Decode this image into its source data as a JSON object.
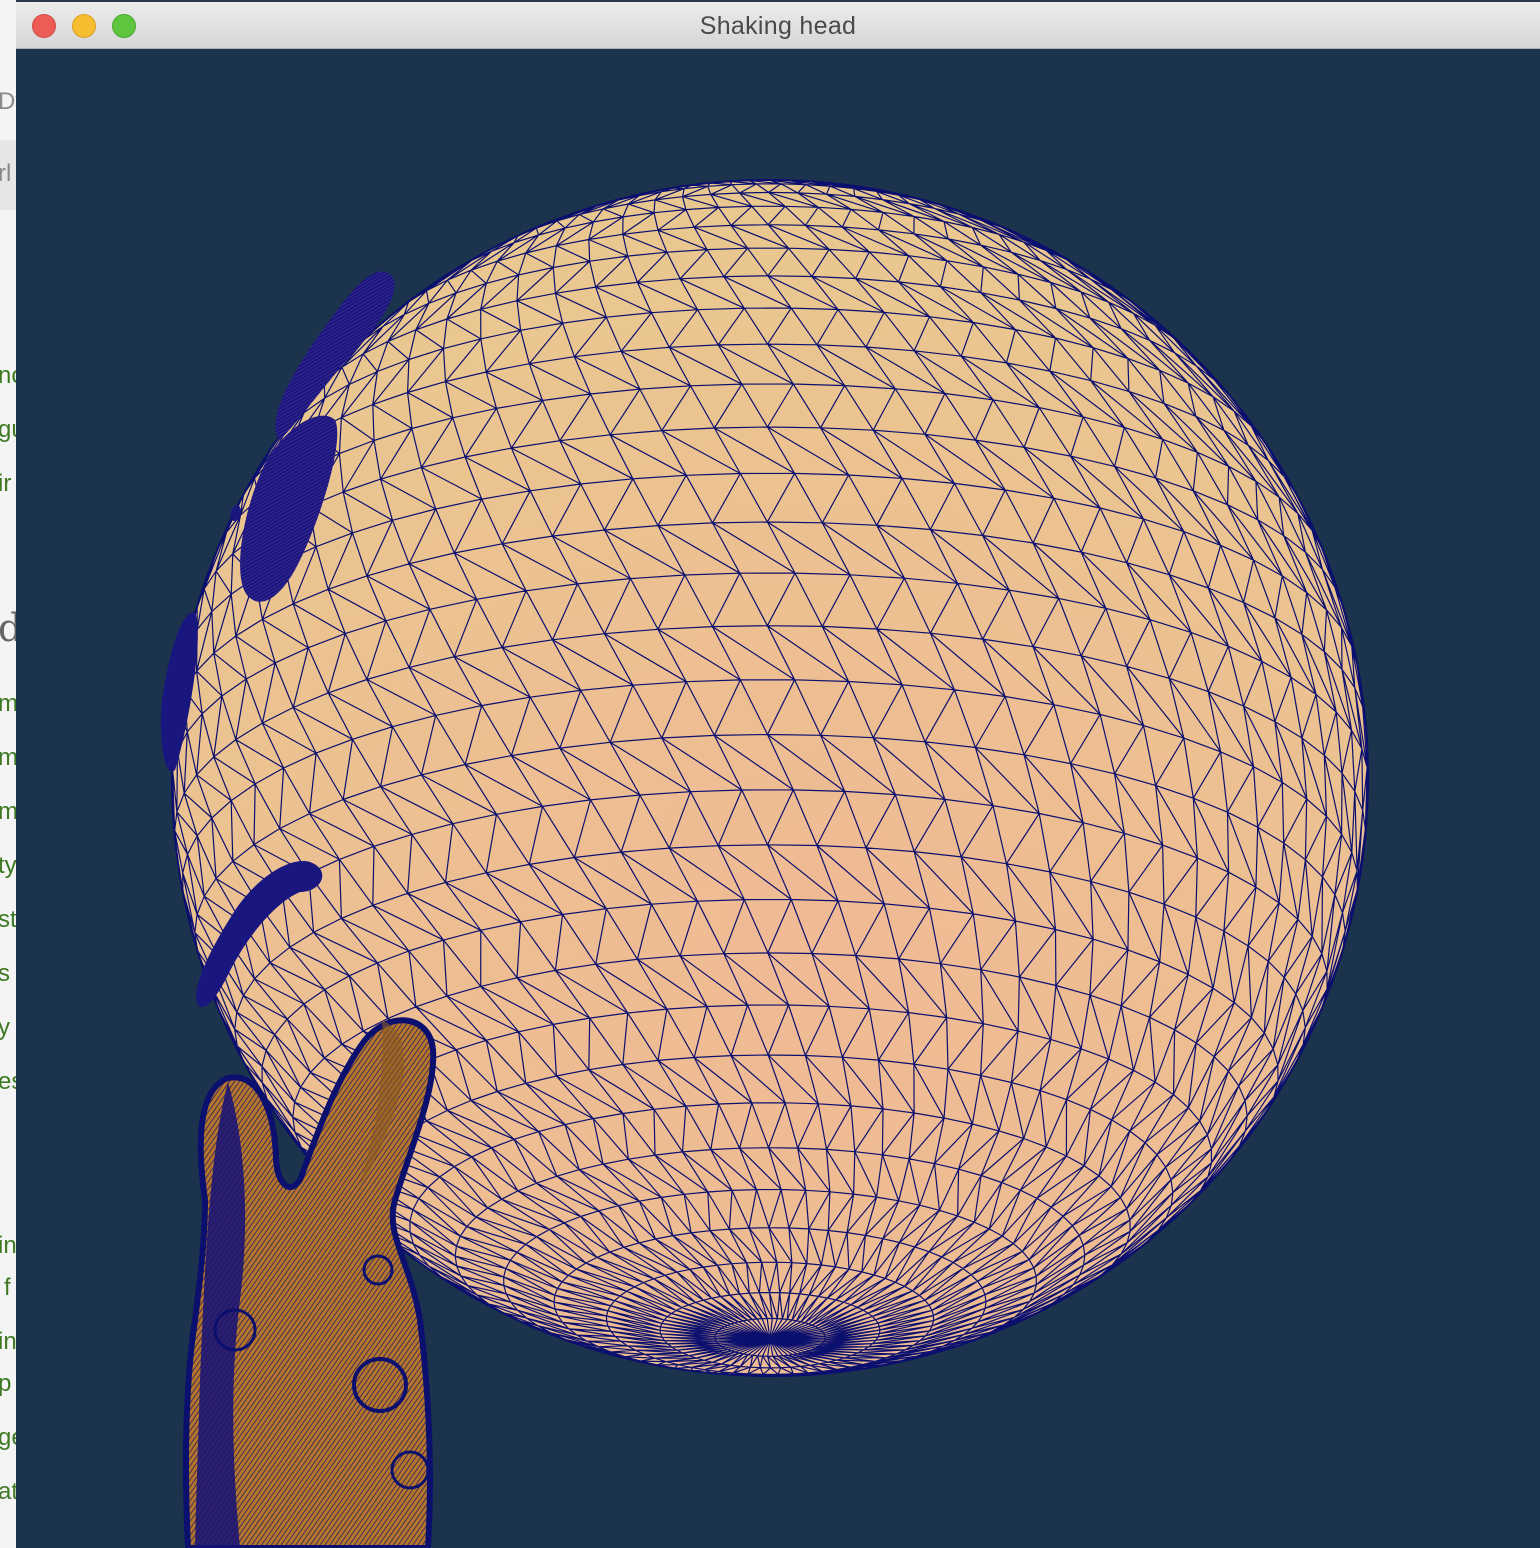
{
  "window": {
    "title": "Shaking head"
  },
  "background_window": {
    "fragments": [
      "Dv",
      "rl",
      "nc",
      "gu",
      "ir",
      "d",
      "m",
      "m",
      "m",
      "ty",
      "st",
      "s",
      "y s",
      "es",
      "in",
      "f",
      "in",
      "p",
      "ge",
      "at"
    ]
  },
  "scene": {
    "background_color": "#1b334c",
    "wire_color": "#0b0f6e",
    "head_shading": [
      "#e8c88f",
      "#f1b896"
    ],
    "bunny_color": "#b6762a"
  }
}
